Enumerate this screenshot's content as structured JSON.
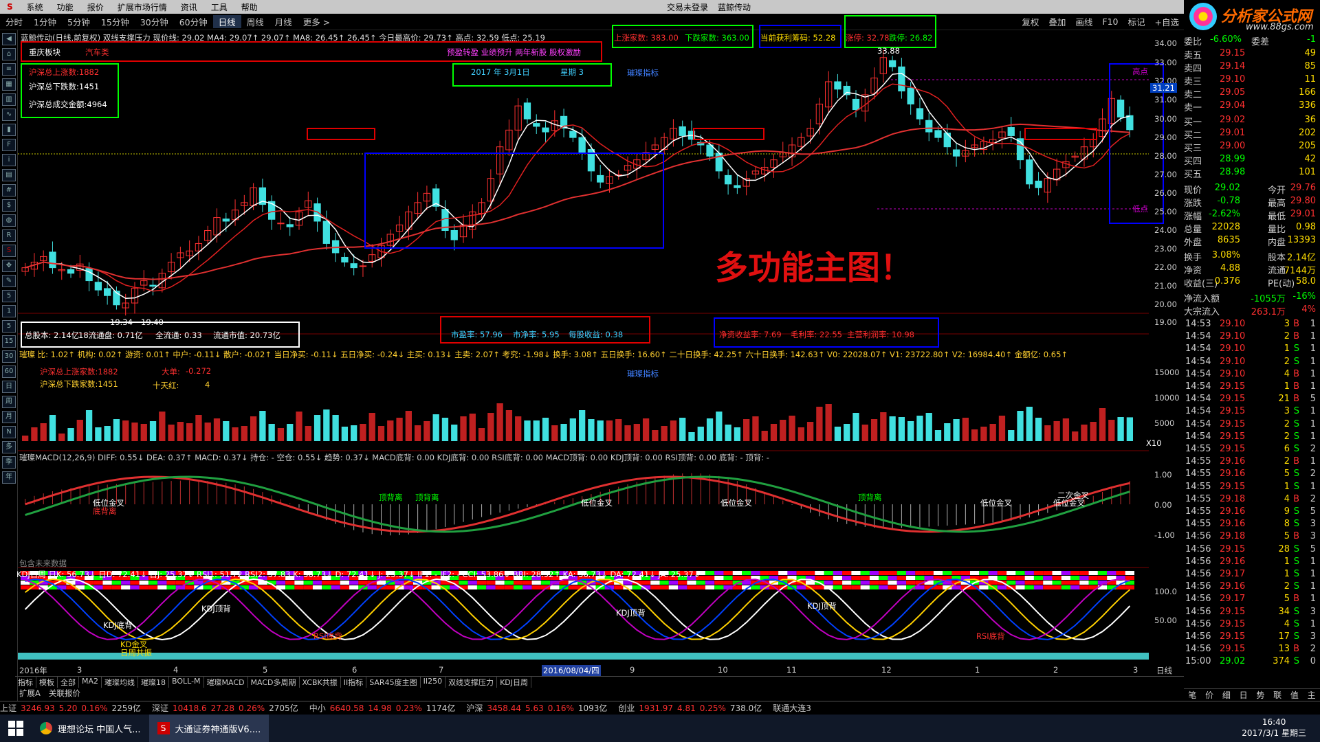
{
  "menu": [
    "系统",
    "功能",
    "报价",
    "扩展市场行情",
    "资讯",
    "工具",
    "帮助"
  ],
  "title_info": [
    "交易未登录",
    "蓝鲸传动"
  ],
  "brand": {
    "name": "分析家公式网",
    "url": "www.88gs.com"
  },
  "periods": [
    "分时",
    "1分钟",
    "5分钟",
    "15分钟",
    "30分钟",
    "60分钟",
    "日线",
    "周线",
    "月线",
    "更多 >"
  ],
  "active_period": "日线",
  "right_tools": [
    "复权",
    "叠加",
    "画线",
    "F10",
    "标记",
    "+自选"
  ],
  "title_line": "蓝鲸传动(日线,前复权)  双线支撑压力  现价线: 29.02   MA4: 29.07↑ 29.07↑ MA8: 26.45↑ 26.45↑  今日最高价: 29.73↑ 高点: 32.59 低点: 25.19",
  "sector": {
    "label": "重庆板块",
    "name": "汽车类",
    "concepts": "预盈转盈 业绩预升 两年新股 股权激励"
  },
  "market_stats": {
    "up_count": "沪深总上涨数:1882",
    "down_count": "沪深总下跌数:1451",
    "amount": "沪深总成交金额:4964"
  },
  "date_line": {
    "date": "2017 年 3月1日",
    "weekday": "星期   3"
  },
  "caption": "多功能主图！",
  "main_panel_label": "璀璨指标",
  "breadth": {
    "up": "上涨家数: 383.00",
    "down": "下跌家数: 363.00"
  },
  "profit": "当前获利筹码: 52.28",
  "limit": {
    "up": "涨停: 32.78",
    "down": "跌停: 26.82"
  },
  "peak_label": "33.88",
  "hi_label": "高点",
  "lo_label": "低点",
  "price_now_tag": "31.21",
  "low_labels": [
    "19.34",
    "19.40"
  ],
  "fund_line": {
    "total": "总股本: 2.14亿",
    "a": "18流通盘: 0.71亿",
    "b": "全流通: 0.33",
    "c": "流通市值: 20.73亿"
  },
  "valuation": {
    "pe": "市盈率: 57.96",
    "pb": "市净率: 5.95",
    "eps": "每股收益: 0.38"
  },
  "profitability": {
    "roe": "净资收益率: 7.69",
    "gm": "毛利率: 22.55",
    "nm": "主营利润率: 10.98"
  },
  "vol_line": "璀璨   比: 1.02↑  机构: 0.02↑  游资: 0.01↑  中户: -0.11↓  散户: -0.02↑  当日净买: -0.11↓  五日净买: -0.24↓  主买: 0.13↓  主卖: 2.07↑  考究: -1.98↓  换手: 3.08↑  五日换手: 16.60↑  二十日换手: 42.25↑  六十日换手: 142.63↑  V0: 22028.07↑  V1: 23722.80↑  V2: 16984.40↑  金额亿: 0.65↑",
  "vol_stats": {
    "up": "沪深总上涨家数:1882",
    "down": "沪深总下跌家数:1451",
    "dadan_label": "大单:",
    "dadan": "-0.272",
    "ten_label": "十天红:",
    "ten": "4"
  },
  "vol_label": "璀璨指标",
  "vol_ticks": [
    "15000",
    "10000",
    "5000",
    "X10"
  ],
  "macd_line": "璀璨MACD(12,26,9)  DIFF: 0.55↓  DEA: 0.37↑  MACD: 0.37↓  持仓: -  空仓: 0.55↓  趋势: 0.37↓   MACD底背: 0.00  KDJ底背: 0.00  RSI底背: 0.00  MACD顶背: 0.00  KDJ顶背: 0.00  RSI顶背: 0.00     底背: -   顶背: -",
  "macd_ticks": [
    "1.00",
    "0.00",
    "-1.00"
  ],
  "macd_notes": [
    "低位金叉",
    "底背离",
    "顶背离",
    "顶背离",
    "低位金叉",
    "低位金叉",
    "顶背离",
    "低位金叉",
    "低位金叉",
    "二次金叉"
  ],
  "macd_foot": "包含未来数据",
  "kdj_line": "KDJ日周  日K: 56.73↓  日D: 72.41↓  日J: 25.37↓          RSI1: 51.72  RSI2: 57.83   K: 56.73↓  D: 72.41↓  J: 25.37↓  IF1: -  IF2: -       CCI: 53.86↓   BBI: 28.92↑   KA: 56.73↓  DA: 72.41↓  JA: 25.37↓",
  "kdj_ticks": [
    "100.0",
    "50.00"
  ],
  "kdj_notes": [
    "KDJ底背",
    "KDJ顶背",
    "RSI底背",
    "KDJ顶背",
    "KDJ顶背",
    "RSI底背",
    "KD金叉",
    "日周共振"
  ],
  "xaxis": [
    "2016年",
    "3",
    "4",
    "5",
    "6",
    "7",
    "2016/08/04/四",
    "9",
    "10",
    "11",
    "12",
    "1",
    "2",
    "3"
  ],
  "x_right": "日线",
  "tabs": [
    "指标",
    "模板",
    "全部",
    "MA2",
    "璀璨均线",
    "璀璨18",
    "BOLL-M",
    "璀璨MACD",
    "MACD多周期",
    "XCBK共振",
    "II指标",
    "SAR45度主图",
    "II250",
    "双线支撑压力",
    "KDJ日周"
  ],
  "ext_row": [
    "扩展A",
    "关联报价"
  ],
  "ticker": [
    {
      "name": "上证",
      "v": "3246.93",
      "c": "5.20",
      "p": "0.16%",
      "a": "2259亿"
    },
    {
      "name": "深证",
      "v": "10418.6",
      "c": "27.28",
      "p": "0.26%",
      "a": "2705亿"
    },
    {
      "name": "中小",
      "v": "6640.58",
      "c": "14.98",
      "p": "0.23%",
      "a": "1174亿"
    },
    {
      "name": "沪深",
      "v": "3458.44",
      "c": "5.63",
      "p": "0.16%",
      "a": "1093亿"
    },
    {
      "name": "创业",
      "v": "1931.97",
      "c": "4.81",
      "p": "0.25%",
      "a": "738.0亿"
    }
  ],
  "ticker_extra": "联通大连3",
  "yaxis": [
    "34.00",
    "33.00",
    "32.00",
    "31.00",
    "30.00",
    "29.00",
    "28.00",
    "27.00",
    "26.00",
    "25.00",
    "24.00",
    "23.00",
    "22.00",
    "21.00",
    "20.00",
    "19.00"
  ],
  "quote": {
    "wb": {
      "label": "委比",
      "v": "-6.60%",
      "label2": "委差",
      "v2": "-1"
    },
    "asks": [
      [
        "卖五",
        "29.15",
        "49"
      ],
      [
        "卖四",
        "29.14",
        "85"
      ],
      [
        "卖三",
        "29.10",
        "11"
      ],
      [
        "卖二",
        "29.05",
        "166"
      ],
      [
        "卖一",
        "29.04",
        "336"
      ]
    ],
    "bids": [
      [
        "买一",
        "29.02",
        "36"
      ],
      [
        "买二",
        "29.01",
        "202"
      ],
      [
        "买三",
        "29.00",
        "205"
      ],
      [
        "买四",
        "28.99",
        "42"
      ],
      [
        "买五",
        "28.98",
        "101"
      ]
    ],
    "stats": [
      [
        "现价",
        "29.02",
        "今开",
        "29.76"
      ],
      [
        "涨跌",
        "-0.78",
        "最高",
        "29.80"
      ],
      [
        "涨幅",
        "-2.62%",
        "最低",
        "29.01"
      ],
      [
        "总量",
        "22028",
        "量比",
        "0.98"
      ],
      [
        "外盘",
        "8635",
        "内盘",
        "13393"
      ]
    ],
    "stats2": [
      [
        "换手",
        "3.08%",
        "股本",
        "2.14亿"
      ],
      [
        "净资",
        "4.88",
        "流通",
        "7144万"
      ],
      [
        "收益(三)",
        "0.376",
        "PE(动)",
        "58.0"
      ]
    ],
    "flow": [
      [
        "净流入额",
        "-1055万",
        "-16%"
      ],
      [
        "大宗流入",
        "263.1万",
        "4%"
      ]
    ],
    "ticks": [
      [
        "14:53",
        "29.10",
        "3",
        "B",
        "1"
      ],
      [
        "14:54",
        "29.10",
        "2",
        "B",
        "1"
      ],
      [
        "14:54",
        "29.10",
        "1",
        "S",
        "1"
      ],
      [
        "14:54",
        "29.10",
        "2",
        "S",
        "1"
      ],
      [
        "14:54",
        "29.10",
        "4",
        "B",
        "1"
      ],
      [
        "14:54",
        "29.15",
        "1",
        "B",
        "1"
      ],
      [
        "14:54",
        "29.15",
        "21",
        "B",
        "5"
      ],
      [
        "14:54",
        "29.15",
        "3",
        "S",
        "1"
      ],
      [
        "14:54",
        "29.15",
        "2",
        "S",
        "1"
      ],
      [
        "14:54",
        "29.15",
        "2",
        "S",
        "1"
      ],
      [
        "14:55",
        "29.15",
        "6",
        "S",
        "2"
      ],
      [
        "14:55",
        "29.16",
        "2",
        "B",
        "1"
      ],
      [
        "14:55",
        "29.16",
        "5",
        "S",
        "2"
      ],
      [
        "14:55",
        "29.15",
        "1",
        "S",
        "1"
      ],
      [
        "14:55",
        "29.18",
        "4",
        "B",
        "2"
      ],
      [
        "14:55",
        "29.16",
        "9",
        "S",
        "5"
      ],
      [
        "14:55",
        "29.16",
        "8",
        "S",
        "3"
      ],
      [
        "14:56",
        "29.18",
        "5",
        "B",
        "3"
      ],
      [
        "14:56",
        "29.15",
        "28",
        "S",
        "5"
      ],
      [
        "14:56",
        "29.16",
        "1",
        "S",
        "1"
      ],
      [
        "14:56",
        "29.17",
        "1",
        "S",
        "1"
      ],
      [
        "14:56",
        "29.16",
        "2",
        "S",
        "1"
      ],
      [
        "14:56",
        "29.17",
        "5",
        "B",
        "1"
      ],
      [
        "14:56",
        "29.15",
        "34",
        "S",
        "3"
      ],
      [
        "14:56",
        "29.15",
        "4",
        "S",
        "1"
      ],
      [
        "14:56",
        "29.15",
        "17",
        "S",
        "3"
      ],
      [
        "14:56",
        "29.15",
        "13",
        "B",
        "2"
      ],
      [
        "15:00",
        "29.02",
        "374",
        "S",
        "0"
      ]
    ],
    "bottom_tabs": [
      "笔",
      "价",
      "细",
      "日",
      "势",
      "联",
      "值",
      "主"
    ]
  },
  "taskbar": [
    {
      "label": "理想论坛 中国人气..."
    },
    {
      "label": "大通证券神通版V6...."
    }
  ],
  "clock": {
    "time": "16:40",
    "date": "2017/3/1 星期三"
  },
  "chart_data": {
    "type": "candlestick",
    "price_axis": [
      19,
      34
    ],
    "closes": [
      21.6,
      21.9,
      22.2,
      21.6,
      21.5,
      21.3,
      21.8,
      20.9,
      20.4,
      20.1,
      19.6,
      19.7,
      20.5,
      20.9,
      20.6,
      21.3,
      21.9,
      22.4,
      22.5,
      22.9,
      23.6,
      24.3,
      24.1,
      24.7,
      25.1,
      25.9,
      25.0,
      24.2,
      24.0,
      23.8,
      24.6,
      25.2,
      24.1,
      22.9,
      22.4,
      21.9,
      21.6,
      21.7,
      22.3,
      22.8,
      23.4,
      23.9,
      24.6,
      25.1,
      25.6,
      24.9,
      23.6,
      23.1,
      23.9,
      24.6,
      25.1,
      26.4,
      28.1,
      29.0,
      30.3,
      29.6,
      29.2,
      28.9,
      29.5,
      29.1,
      28.6,
      27.8,
      26.8,
      26.2,
      26.5,
      26.6,
      27.1,
      27.4,
      27.8,
      28.2,
      28.6,
      29.1,
      28.7,
      28.5,
      28.2,
      27.6,
      26.8,
      26.1,
      25.9,
      26.4,
      26.8,
      27.0,
      27.4,
      27.8,
      28.2,
      28.6,
      29.1,
      30.4,
      31.6,
      31.2,
      30.9,
      30.1,
      30.9,
      31.8,
      32.9,
      32.4,
      31.1,
      30.4,
      29.6,
      28.9,
      28.6,
      28.1,
      27.6,
      27.9,
      28.2,
      28.4,
      28.5,
      28.9,
      28.7,
      27.4,
      26.1,
      25.9,
      26.4,
      26.9,
      27.3,
      27.6,
      28.1,
      28.5,
      29.6,
      30.7,
      29.7,
      29.02
    ],
    "volume_axis": [
      0,
      15000
    ],
    "macd_axis": [
      -1,
      1
    ],
    "kdj_axis": [
      0,
      100
    ]
  }
}
